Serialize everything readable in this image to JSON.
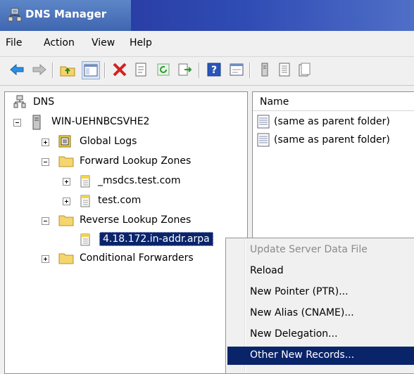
{
  "window": {
    "title": "DNS Manager"
  },
  "menu": {
    "items": [
      {
        "label": "File"
      },
      {
        "label": "Action"
      },
      {
        "label": "View"
      },
      {
        "label": "Help"
      }
    ]
  },
  "toolbar": {
    "buttons": [
      "back-arrow-icon",
      "forward-arrow-icon",
      "up-folder-icon",
      "show-hide-tree-icon",
      "delete-icon",
      "properties-icon",
      "refresh-icon",
      "export-list-icon",
      "help-icon",
      "console-icon",
      "server-icon",
      "zone-icon",
      "record-icon"
    ]
  },
  "tree": {
    "root": "DNS",
    "server": "WIN-UEHNBCSVHE2",
    "global_logs": "Global Logs",
    "forward_zones": "Forward Lookup Zones",
    "msdcs": "_msdcs.test.com",
    "test": "test.com",
    "reverse_zones": "Reverse Lookup Zones",
    "reverse_zone_selected": "4.18.172.in-addr.arpa",
    "conditional_forwarders": "Conditional Forwarders"
  },
  "list": {
    "header": "Name",
    "rows": [
      {
        "name": "(same as parent folder)"
      },
      {
        "name": "(same as parent folder)"
      }
    ]
  },
  "context_menu": {
    "items": [
      {
        "label": "Update Server Data File",
        "disabled": true
      },
      {
        "label": "Reload"
      },
      {
        "label": "New Pointer (PTR)..."
      },
      {
        "label": "New Alias (CNAME)..."
      },
      {
        "label": "New Delegation..."
      },
      {
        "label": "Other New Records...",
        "highlighted": true
      }
    ]
  },
  "colors": {
    "selection": "#0a246a",
    "title_bar": "#2343a8"
  }
}
